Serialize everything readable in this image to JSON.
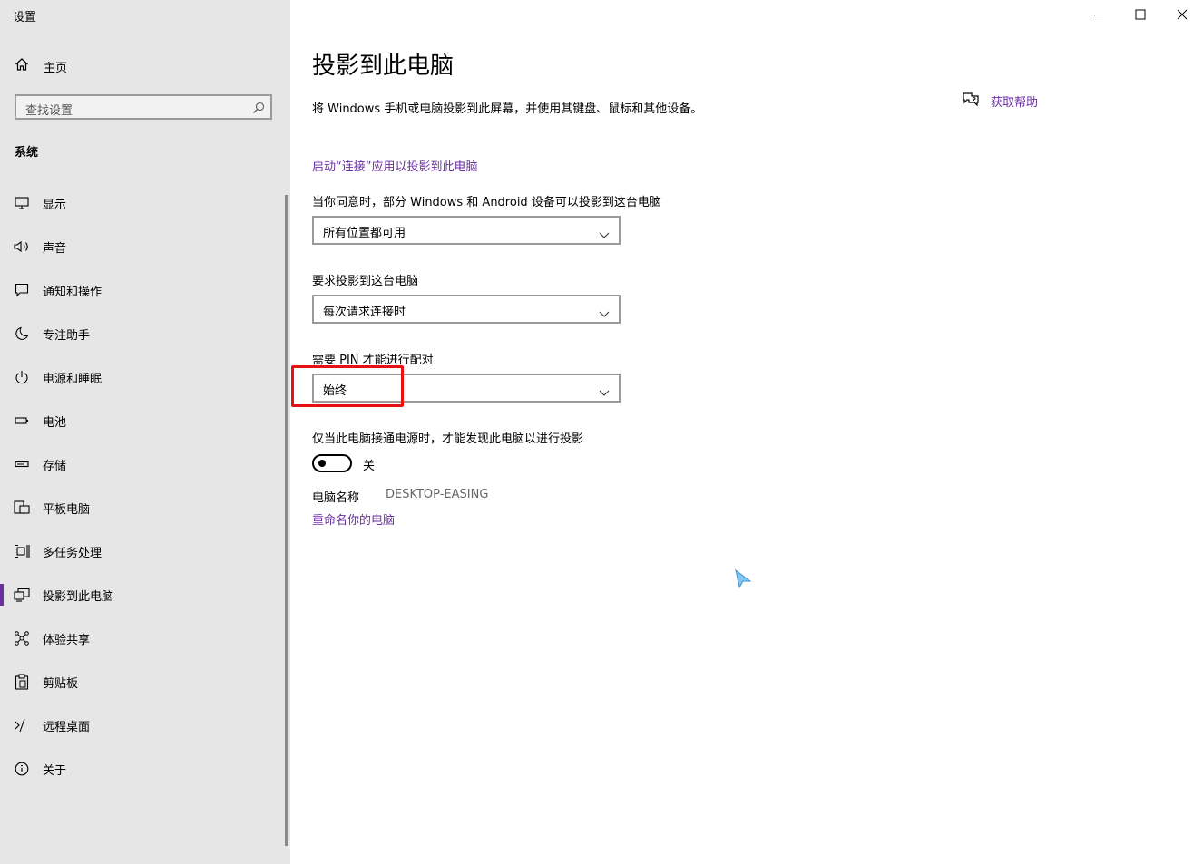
{
  "app": {
    "title": "设置"
  },
  "window_controls": {
    "minimize_icon": "minimize-icon",
    "maximize_icon": "maximize-icon",
    "close_icon": "close-icon"
  },
  "sidebar": {
    "home_label": "主页",
    "search_placeholder": "查找设置",
    "section_title": "系统",
    "items": [
      {
        "label": "显示",
        "icon": "monitor-icon"
      },
      {
        "label": "声音",
        "icon": "speaker-icon"
      },
      {
        "label": "通知和操作",
        "icon": "notification-icon"
      },
      {
        "label": "专注助手",
        "icon": "moon-icon"
      },
      {
        "label": "电源和睡眠",
        "icon": "power-icon"
      },
      {
        "label": "电池",
        "icon": "battery-icon"
      },
      {
        "label": "存储",
        "icon": "storage-icon"
      },
      {
        "label": "平板电脑",
        "icon": "tablet-icon"
      },
      {
        "label": "多任务处理",
        "icon": "multitask-icon"
      },
      {
        "label": "投影到此电脑",
        "icon": "project-icon",
        "active": true
      },
      {
        "label": "体验共享",
        "icon": "share-icon"
      },
      {
        "label": "剪贴板",
        "icon": "clipboard-icon"
      },
      {
        "label": "远程桌面",
        "icon": "remote-desktop-icon"
      },
      {
        "label": "关于",
        "icon": "info-icon"
      }
    ]
  },
  "main": {
    "title": "投影到此电脑",
    "description": "将 Windows 手机或电脑投影到此屏幕，并使用其键盘、鼠标和其他设备。",
    "connect_link": "启动“连接”应用以投影到此电脑",
    "availability": {
      "label": "当你同意时，部分 Windows 和 Android 设备可以投影到这台电脑",
      "value": "所有位置都可用"
    },
    "request": {
      "label": "要求投影到这台电脑",
      "value": "每次请求连接时"
    },
    "pin": {
      "label": "需要 PIN 才能进行配对",
      "value": "始终"
    },
    "power_only": {
      "label": "仅当此电脑接通电源时，才能发现此电脑以进行投影",
      "state": "关"
    },
    "pc_name": {
      "label": "电脑名称",
      "value": "DESKTOP-EASING"
    },
    "rename_link": "重命名你的电脑",
    "help": {
      "label": "获取帮助",
      "icon": "chat-help-icon"
    }
  },
  "colors": {
    "accent": "#6b2fa0",
    "highlight": "#e81010",
    "sidebar_bg": "#e6e6e6"
  }
}
